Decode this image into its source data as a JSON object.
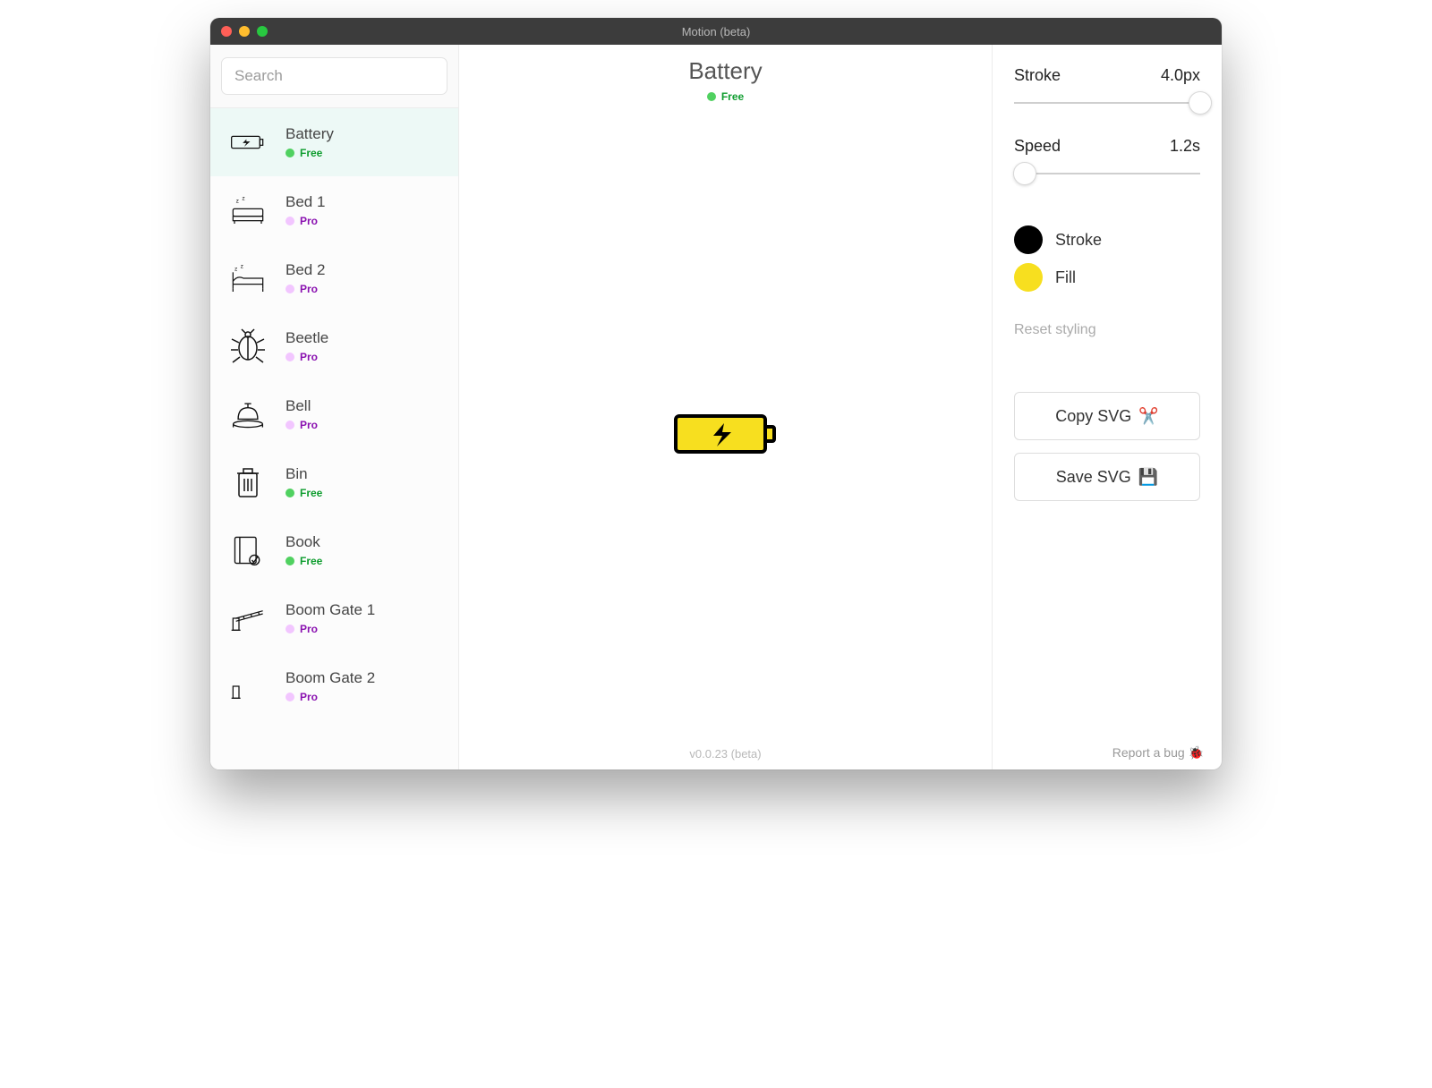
{
  "window": {
    "title": "Motion (beta)"
  },
  "search": {
    "placeholder": "Search",
    "value": ""
  },
  "sidebar": {
    "items": [
      {
        "name": "Battery",
        "tier": "Free",
        "icon": "battery",
        "selected": true
      },
      {
        "name": "Bed 1",
        "tier": "Pro",
        "icon": "bed1",
        "selected": false
      },
      {
        "name": "Bed 2",
        "tier": "Pro",
        "icon": "bed2",
        "selected": false
      },
      {
        "name": "Beetle",
        "tier": "Pro",
        "icon": "beetle",
        "selected": false
      },
      {
        "name": "Bell",
        "tier": "Pro",
        "icon": "bell",
        "selected": false
      },
      {
        "name": "Bin",
        "tier": "Free",
        "icon": "bin",
        "selected": false
      },
      {
        "name": "Book",
        "tier": "Free",
        "icon": "book",
        "selected": false
      },
      {
        "name": "Boom Gate 1",
        "tier": "Pro",
        "icon": "boomgate1",
        "selected": false
      },
      {
        "name": "Boom Gate 2",
        "tier": "Pro",
        "icon": "boomgate2",
        "selected": false
      }
    ]
  },
  "main": {
    "title": "Battery",
    "tier": "Free",
    "version": "v0.0.23 (beta)"
  },
  "inspector": {
    "stroke_label": "Stroke",
    "stroke_value": "4.0px",
    "stroke_slider_pct": 100,
    "speed_label": "Speed",
    "speed_value": "1.2s",
    "speed_slider_pct": 6,
    "color_stroke_label": "Stroke",
    "color_stroke_hex": "#000000",
    "color_fill_label": "Fill",
    "color_fill_hex": "#f7df1f",
    "reset_label": "Reset styling",
    "copy_label": "Copy SVG",
    "copy_icon": "✂️",
    "save_label": "Save SVG",
    "save_icon": "💾",
    "report_label": "Report a bug",
    "report_icon": "🐞"
  }
}
